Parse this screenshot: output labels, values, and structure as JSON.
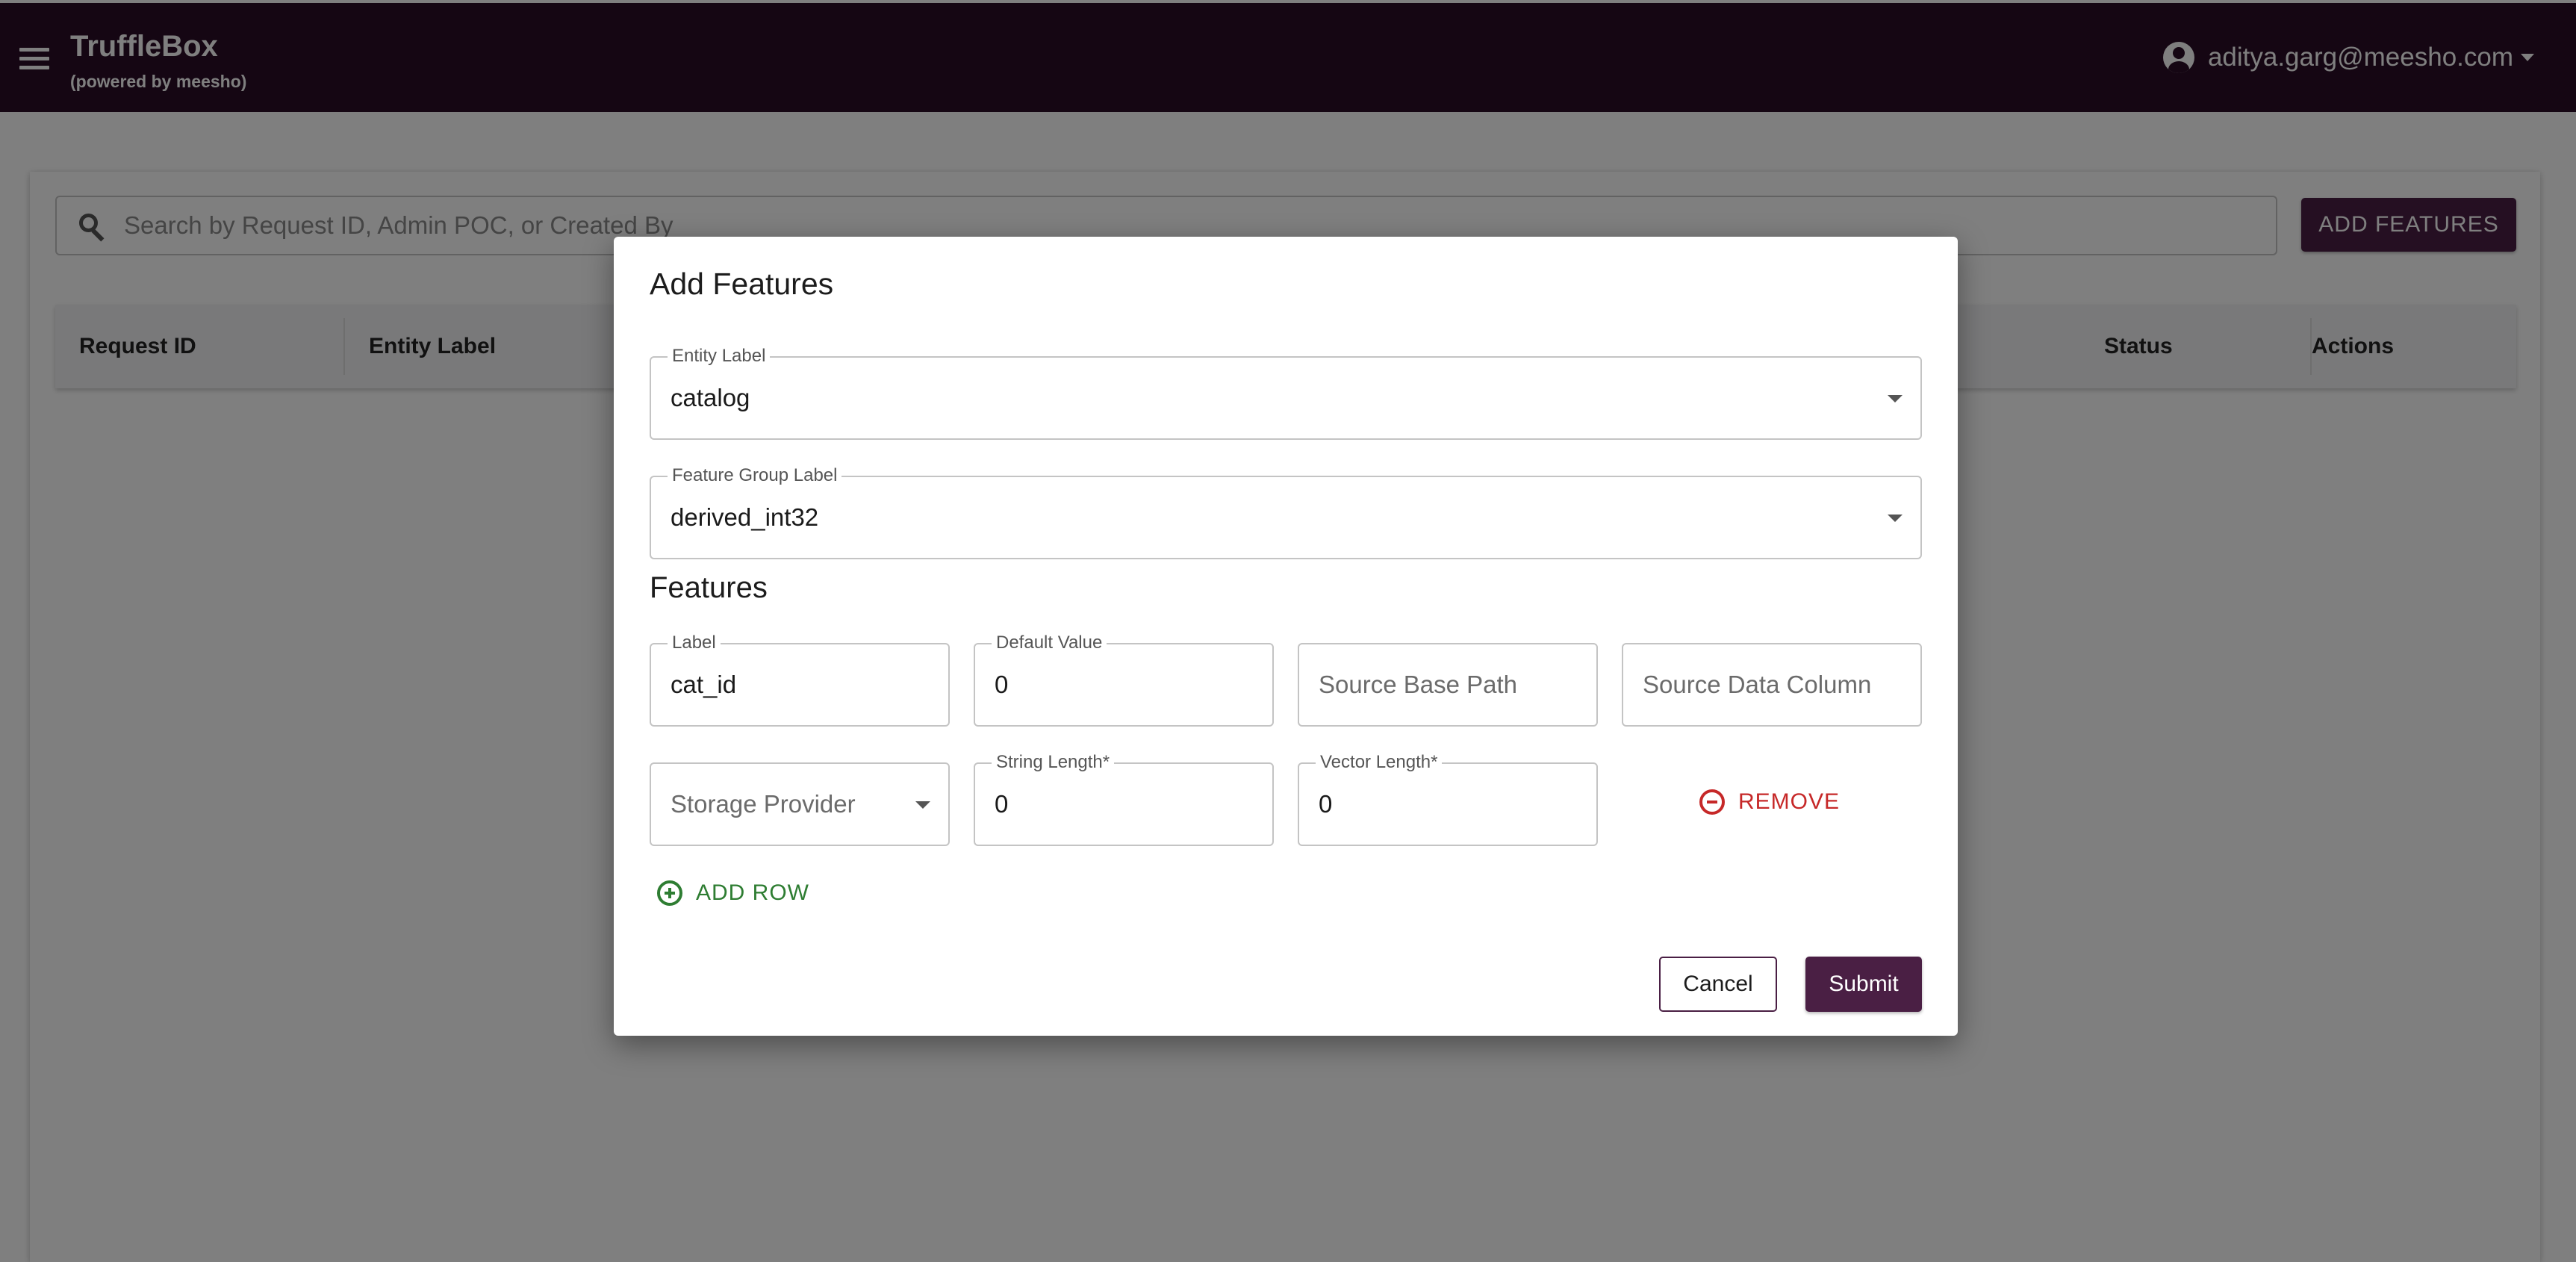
{
  "header": {
    "title": "TruffleBox",
    "subtitle": "(powered by meesho)",
    "user_email": "aditya.garg@meesho.com"
  },
  "search": {
    "placeholder": "Search by Request ID, Admin POC, or Created By",
    "value": ""
  },
  "toolbar": {
    "add_features_label": "ADD FEATURES"
  },
  "table": {
    "columns": [
      "Request ID",
      "Entity Label",
      "Status",
      "Actions"
    ]
  },
  "dialog": {
    "title": "Add Features",
    "entity_label": {
      "label": "Entity Label",
      "value": "catalog"
    },
    "feature_group_label": {
      "label": "Feature Group Label",
      "value": "derived_int32"
    },
    "features_title": "Features",
    "row": {
      "label": {
        "label": "Label",
        "value": "cat_id"
      },
      "default_value": {
        "label": "Default Value",
        "value": "0"
      },
      "source_base_path": {
        "placeholder": "Source Base Path"
      },
      "source_data_column": {
        "placeholder": "Source Data Column"
      },
      "storage_provider": {
        "placeholder": "Storage Provider"
      },
      "string_length": {
        "label": "String Length",
        "required_mark": "*",
        "value": "0"
      },
      "vector_length": {
        "label": "Vector Length",
        "required_mark": "*",
        "value": "0"
      },
      "remove_label": "REMOVE"
    },
    "add_row_label": "ADD ROW",
    "cancel_label": "Cancel",
    "submit_label": "Submit"
  },
  "colors": {
    "appbar": "#2a0d26",
    "primary": "#4a1f44",
    "remove": "#c62828",
    "add": "#2e7d32"
  }
}
